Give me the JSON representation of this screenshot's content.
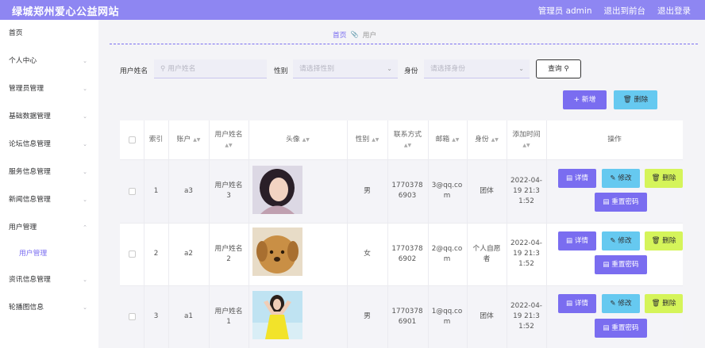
{
  "header": {
    "site_title": "绿城郑州爱心公益网站",
    "admin_label": "管理员 admin",
    "front_label": "退出到前台",
    "logout_label": "退出登录"
  },
  "sidebar": {
    "items": [
      {
        "label": "首页",
        "chevron": ""
      },
      {
        "label": "个人中心",
        "chevron": "⌄"
      },
      {
        "label": "管理员管理",
        "chevron": "⌄"
      },
      {
        "label": "基础数据管理",
        "chevron": "⌄"
      },
      {
        "label": "论坛信息管理",
        "chevron": "⌄"
      },
      {
        "label": "服务信息管理",
        "chevron": "⌄"
      },
      {
        "label": "新闻信息管理",
        "chevron": "⌄"
      },
      {
        "label": "用户管理",
        "chevron": "⌃"
      },
      {
        "label": "用户管理",
        "chevron": ""
      },
      {
        "label": "资讯信息管理",
        "chevron": "⌄"
      },
      {
        "label": "轮播图信息",
        "chevron": "⌄"
      }
    ]
  },
  "breadcrumb": {
    "home": "首页",
    "current": "用户",
    "sep_icon": "clip-icon"
  },
  "search": {
    "name_label": "用户姓名",
    "name_placeholder": "用户姓名",
    "gender_label": "性别",
    "gender_placeholder": "请选择性别",
    "identity_label": "身份",
    "identity_placeholder": "请选择身份",
    "query_button": "查询"
  },
  "actions": {
    "add": "新增",
    "delete": "删除"
  },
  "table": {
    "headers": {
      "index": "索引",
      "account": "账户",
      "name": "用户姓名",
      "avatar": "头像",
      "gender": "性别",
      "phone": "联系方式",
      "email": "邮箱",
      "identity": "身份",
      "added": "添加时间",
      "operation": "操作"
    },
    "ops": {
      "detail": "详情",
      "edit": "修改",
      "delete": "删除",
      "reset": "重置密码"
    },
    "rows": [
      {
        "index": "1",
        "account": "a3",
        "name": "用户姓名3",
        "avatar": "avatar-portrait-woman",
        "gender": "男",
        "phone": "17703786903",
        "email": "3@qq.com",
        "identity": "团体",
        "added": "2022-04-19 21:31:52"
      },
      {
        "index": "2",
        "account": "a2",
        "name": "用户姓名2",
        "avatar": "avatar-puppy",
        "gender": "女",
        "phone": "17703786902",
        "email": "2@qq.com",
        "identity": "个人自愿者",
        "added": "2022-04-19 21:31:52"
      },
      {
        "index": "3",
        "account": "a1",
        "name": "用户姓名1",
        "avatar": "avatar-woman-yellow-dress",
        "gender": "男",
        "phone": "17703786901",
        "email": "1@qq.com",
        "identity": "团体",
        "added": "2022-04-19 21:31:52"
      }
    ]
  },
  "colors": {
    "primary": "#7a6df0",
    "header": "#8e86f2",
    "info": "#66c9f0",
    "warning": "#d5f45a"
  }
}
